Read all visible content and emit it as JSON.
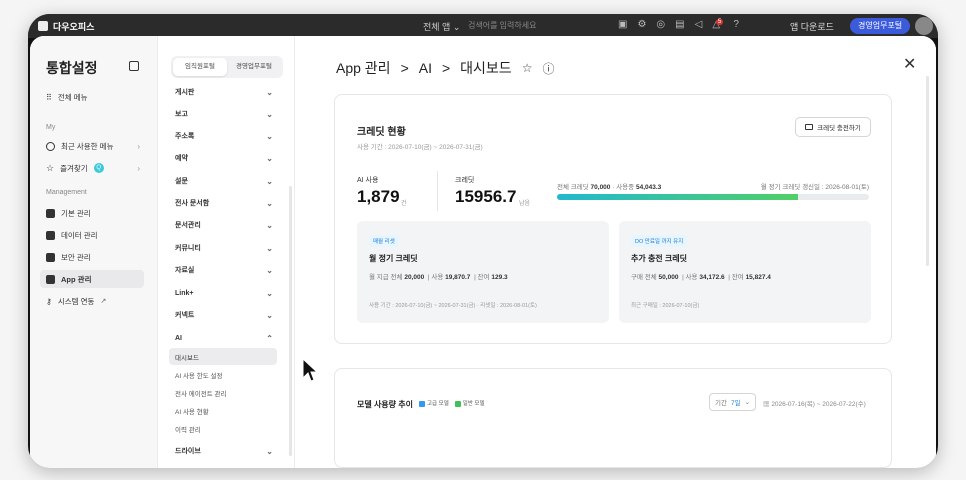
{
  "topbar": {
    "brand": "다우오피스",
    "all_menu": "전체 앱 ⌄",
    "search_placeholder": "검색어를 입력하세요",
    "notif_count": "5",
    "download": "앱 다운로드",
    "portal_btn": "경영업무포털"
  },
  "nav1": {
    "title": "통합설정",
    "all_menu": "전체 메뉴",
    "section_my": "My",
    "recent": "최근 사용한 메뉴",
    "favorites": "즐겨찾기",
    "fav_badge": "Q",
    "section_mgmt": "Management",
    "items": [
      "기본 관리",
      "데이터 관리",
      "보안 관리",
      "App 관리",
      "시스템 연동"
    ]
  },
  "nav2": {
    "tabs": [
      "임직원포털",
      "경영업무포털"
    ],
    "items": [
      "게시판",
      "보고",
      "주소록",
      "예약",
      "설문",
      "전사 문서함",
      "문서관리",
      "커뮤니티",
      "자료실",
      "Link+",
      "커넥트",
      "AI"
    ],
    "ai_sub": [
      "대시보드",
      "AI 사용 한도 설정",
      "전사 에이전트 관리",
      "AI 사용 현황",
      "이력 관리"
    ],
    "last": "드라이브"
  },
  "breadcrumb": {
    "a": "App 관리",
    "sep1": ">",
    "b": "AI",
    "sep2": ">",
    "c": "대시보드"
  },
  "credit": {
    "title": "크레딧 현황",
    "period": "사용 기간 : 2026-07-10(금) ~ 2026-07-31(금)",
    "charge_btn": "크레딧 충전하기",
    "ai_use_label": "AI 사용",
    "ai_use_value": "1,879",
    "ai_use_unit": "건",
    "credit_label": "크레딧",
    "credit_value": "15956.7",
    "credit_unit": "남음",
    "total_label": "전체 크레딧",
    "total_value": "70,000",
    "used_label": "· 사용중",
    "used_value": "54,043.3",
    "renew": "월 정기 크레딧 갱신일 : 2026-08-01(토)",
    "bar_fraction": 0.772,
    "monthly": {
      "tag": "매월 리셋",
      "title": "월 정기 크레딧",
      "paid_label": "월 지급 전체",
      "paid": "20,000",
      "used_label": "| 사용",
      "used": "19,870.7",
      "left_label": "| 잔여",
      "left": "129.3",
      "foot": "사용 기간 : 2026-07-10(금) ~ 2026-07-31(금)  · 리셋일 : 2026-08-01(토)"
    },
    "extra": {
      "tag": "DO 만료일 까지 유지",
      "title": "추가 충전 크레딧",
      "paid_label": "구매 전체",
      "paid": "50,000",
      "used_label": "| 사용",
      "used": "34,172.6",
      "left_label": "| 잔여",
      "left": "15,827.4",
      "foot": "최근 구매일 : 2026-07-10(금)"
    }
  },
  "model": {
    "title": "모델 사용량 추이",
    "legend": [
      "고급 모델",
      "일반 모델"
    ],
    "period_label": "기간",
    "period_value": "7일",
    "range": "2026-07-16(목) ~ 2026-07-22(수)"
  },
  "colors": {
    "accent": "#3b5bdb",
    "legend_a": "#339af0",
    "legend_b": "#40c057"
  }
}
